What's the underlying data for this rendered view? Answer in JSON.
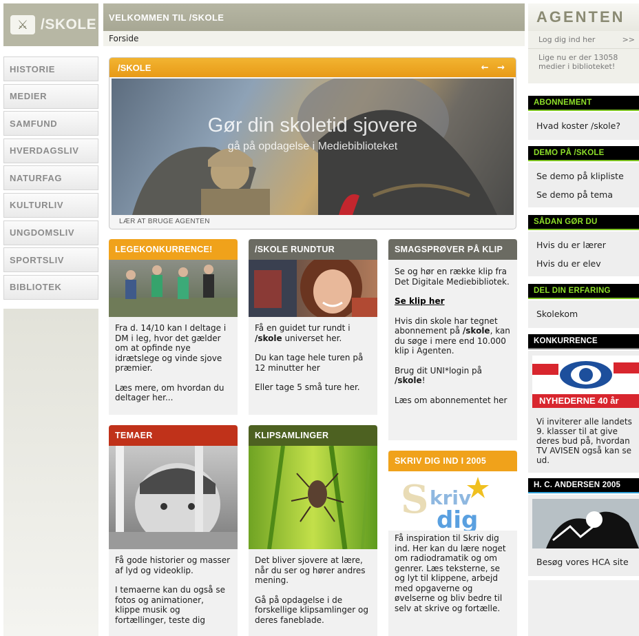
{
  "logo": {
    "icon_glyph": "⚔",
    "text": "/SKOLE"
  },
  "nav": {
    "items": [
      {
        "label": "HISTORIE"
      },
      {
        "label": "MEDIER"
      },
      {
        "label": "SAMFUND"
      },
      {
        "label": "HVERDAGSLIV"
      },
      {
        "label": "NATURFAG"
      },
      {
        "label": "KULTURLIV"
      },
      {
        "label": "UNGDOMSLIV"
      },
      {
        "label": "SPORTSLIV"
      },
      {
        "label": "BIBLIOTEK"
      }
    ]
  },
  "header": {
    "title": "VELKOMMEN TIL /SKOLE",
    "breadcrumb": "Forside"
  },
  "hero": {
    "bar_title": "/SKOLE",
    "arrows": "← →",
    "headline": "Gør din skoletid sjovere",
    "subline": "gå på opdagelse i Mediebiblioteket",
    "footer": "LÆR AT BRUGE AGENTEN"
  },
  "boxes": {
    "lege": {
      "title": "LEGEKONKURRENCE!",
      "color": "#f0a21b",
      "p1": "Fra d. 14/10 kan I deltage i DM i leg, hvor det gælder om at opfinde nye idrætslege og vinde sjove præmier.",
      "p2": "Læs mere, om hvordan du deltager her..."
    },
    "rundtur": {
      "title": "/SKOLE RUNDTUR",
      "color": "#6b6b62",
      "p1_pre": "Få en guidet tur rundt i ",
      "p1_bold": "/skole",
      "p1_post": " universet her.",
      "p2": "Du kan tage hele turen på 12 minutter her",
      "p3": "Eller tage 5 små ture her."
    },
    "smag": {
      "title": "SMAGSPRØVER PÅ KLIP",
      "color": "#6b6b62",
      "p1": "Se og hør en række klip fra Det Digitale Mediebibliotek.",
      "link": "Se klip her",
      "p2_pre": "Hvis din skole har tegnet abonnement på ",
      "p2_bold": "/skole",
      "p2_post": ", kan du søge i mere end 10.000 klip i Agenten.",
      "p3_pre": "Brug dit UNI*login på ",
      "p3_bold": "/skole",
      "p3_post": "!",
      "p4": "Læs om abonnementet her"
    },
    "temaer": {
      "title": "TEMAER",
      "color": "#c0321a",
      "p1": "Få gode historier og masser af lyd og videoklip.",
      "p2": "I temaerne kan du også se fotos og animationer, klippe musik og fortællinger, teste dig"
    },
    "klip": {
      "title": "KLIPSAMLINGER",
      "color": "#4d6121",
      "p1": "Det bliver sjovere at lære, når du ser og hører andres mening.",
      "p2": "Gå på opdagelse i de forskellige klipsamlinger og deres faneblade."
    },
    "skriv": {
      "title": "SKRIV DIG IND I 2005",
      "color": "#f0a21b",
      "logo_text": "Skriv dig",
      "p1": "Få inspiration til Skriv dig ind. Her kan du lære noget om radiodramatik og om genrer. Læs teksterne, se og lyt til klippene, arbejd med opgaverne og øvelserne og bliv bedre til selv at skrive og fortælle."
    }
  },
  "agenten": {
    "logo": "AGENTEN",
    "login_label": "Log dig ind her",
    "login_arrow": ">>",
    "media_count": "Lige nu er der 13058 medier i biblioteket!"
  },
  "right": {
    "abonnement": {
      "title": "ABONNEMENT",
      "links": [
        "Hvad koster /skole?"
      ]
    },
    "demo": {
      "title": "DEMO PÅ /SKOLE",
      "links": [
        "Se demo på klipliste",
        "Se demo på tema"
      ]
    },
    "saadan": {
      "title": "SÅDAN GØR DU",
      "links": [
        "Hvis du er lærer",
        "Hvis du er elev"
      ]
    },
    "del": {
      "title": "DEL DIN ERFARING",
      "links": [
        "Skolekom"
      ]
    },
    "konkurrence": {
      "title": "KONKURRENCE",
      "banner": "NYHEDERNE 40 år",
      "text": "Vi inviterer alle landets 9. klasser til at give deres bud på, hvordan TV AVISEN også kan se ud."
    },
    "hca": {
      "title": "H. C. ANDERSEN 2005",
      "links": [
        "Besøg vores HCA site"
      ]
    }
  }
}
